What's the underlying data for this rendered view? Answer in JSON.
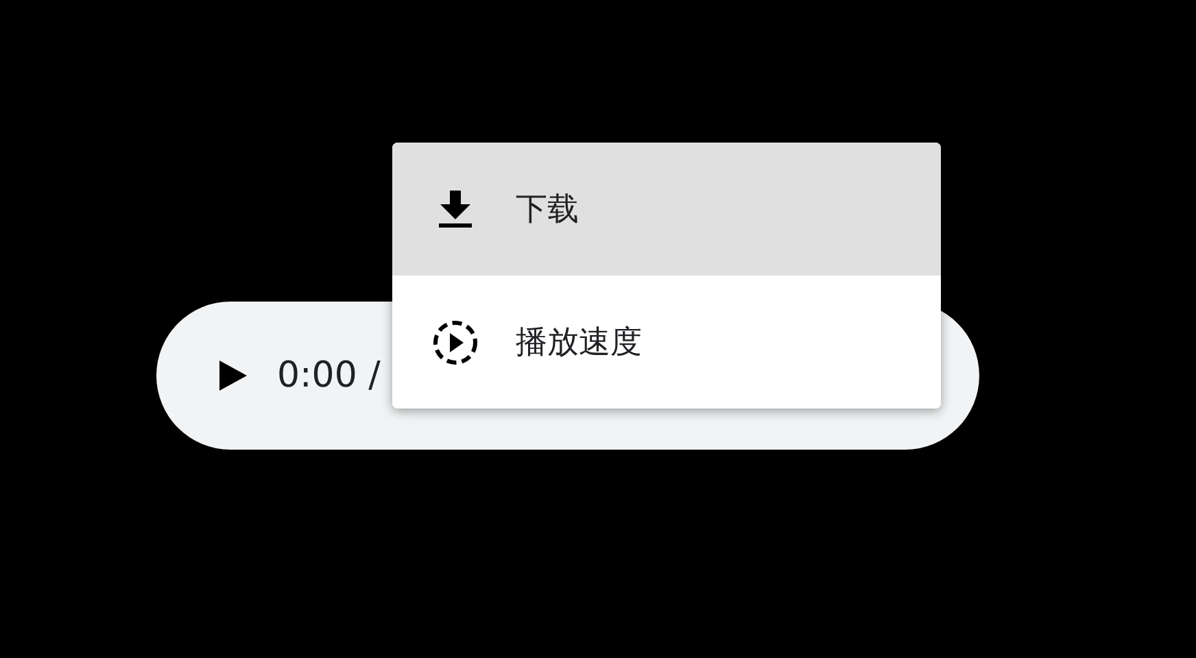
{
  "player": {
    "time": "0:00 /"
  },
  "menu": {
    "items": [
      {
        "kind": "download",
        "label": "下载",
        "selected": true
      },
      {
        "kind": "speed",
        "label": "播放速度",
        "selected": false
      }
    ]
  }
}
